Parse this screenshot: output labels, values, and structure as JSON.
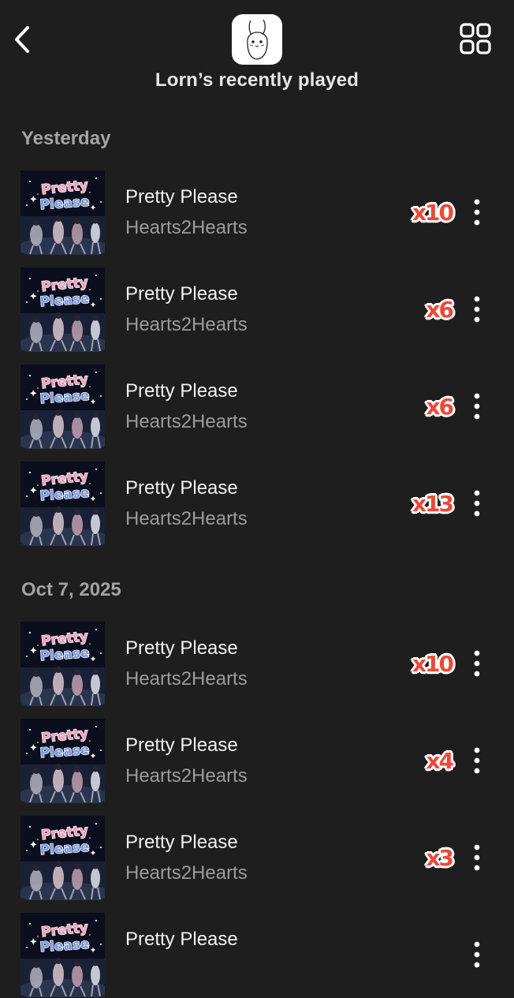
{
  "header": {
    "title": "Lorn’s recently played"
  },
  "art_text": {
    "word1": "Pretty",
    "word2": "Please"
  },
  "sections": [
    {
      "label": "Yesterday",
      "tracks": [
        {
          "title": "Pretty Please",
          "artist": "Hearts2Hearts",
          "play_count": "x10"
        },
        {
          "title": "Pretty Please",
          "artist": "Hearts2Hearts",
          "play_count": "x6"
        },
        {
          "title": "Pretty Please",
          "artist": "Hearts2Hearts",
          "play_count": "x6"
        },
        {
          "title": "Pretty Please",
          "artist": "Hearts2Hearts",
          "play_count": "x13"
        }
      ]
    },
    {
      "label": "Oct 7, 2025",
      "tracks": [
        {
          "title": "Pretty Please",
          "artist": "Hearts2Hearts",
          "play_count": "x10"
        },
        {
          "title": "Pretty Please",
          "artist": "Hearts2Hearts",
          "play_count": "x4"
        },
        {
          "title": "Pretty Please",
          "artist": "Hearts2Hearts",
          "play_count": "x3"
        },
        {
          "title": "Pretty Please",
          "artist": "",
          "play_count": ""
        }
      ]
    }
  ],
  "icons": {
    "back": "chevron-left-icon",
    "view_toggle": "grid-icon",
    "more": "more-vertical-icon",
    "avatar": "bunny-avatar"
  },
  "colors": {
    "background": "#1e1e1e",
    "count_sticker": "#ea4a3a",
    "title_text": "#f2f2f2",
    "secondary_text": "#9c9c9c",
    "section_text": "#a3a3a3"
  }
}
